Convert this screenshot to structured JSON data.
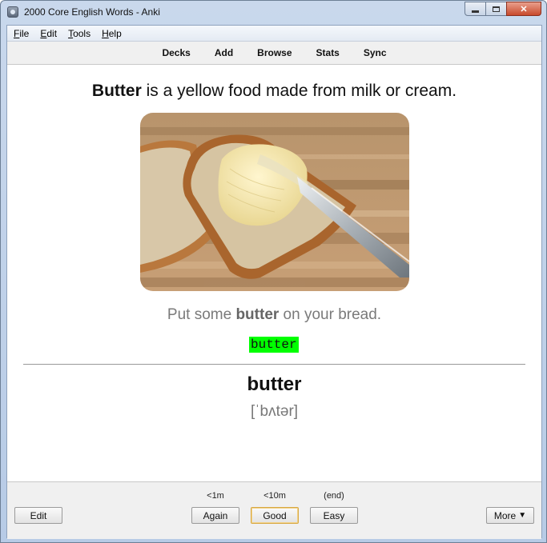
{
  "window": {
    "title": "2000 Core English Words - Anki"
  },
  "menu": {
    "items": [
      {
        "accel": "F",
        "rest": "ile"
      },
      {
        "accel": "E",
        "rest": "dit"
      },
      {
        "accel": "T",
        "rest": "ools"
      },
      {
        "accel": "H",
        "rest": "elp"
      }
    ]
  },
  "toolbar": {
    "decks": "Decks",
    "add": "Add",
    "browse": "Browse",
    "stats": "Stats",
    "sync": "Sync"
  },
  "card": {
    "definition_bold": "Butter",
    "definition_rest": " is a yellow food made from milk or cream.",
    "sentence_pre": "Put some ",
    "sentence_bold": "butter",
    "sentence_post": " on your bread.",
    "typed_answer": "butter",
    "word": "butter",
    "ipa": "[ˈbʌtər]"
  },
  "answer_bar": {
    "edit": "Edit",
    "again": {
      "label": "Again",
      "interval": "<1m"
    },
    "good": {
      "label": "Good",
      "interval": "<10m"
    },
    "easy": {
      "label": "Easy",
      "interval": "(end)"
    },
    "more": "More"
  },
  "colors": {
    "typed_highlight": "#00ff00",
    "default_button_border": "#d7a843"
  }
}
